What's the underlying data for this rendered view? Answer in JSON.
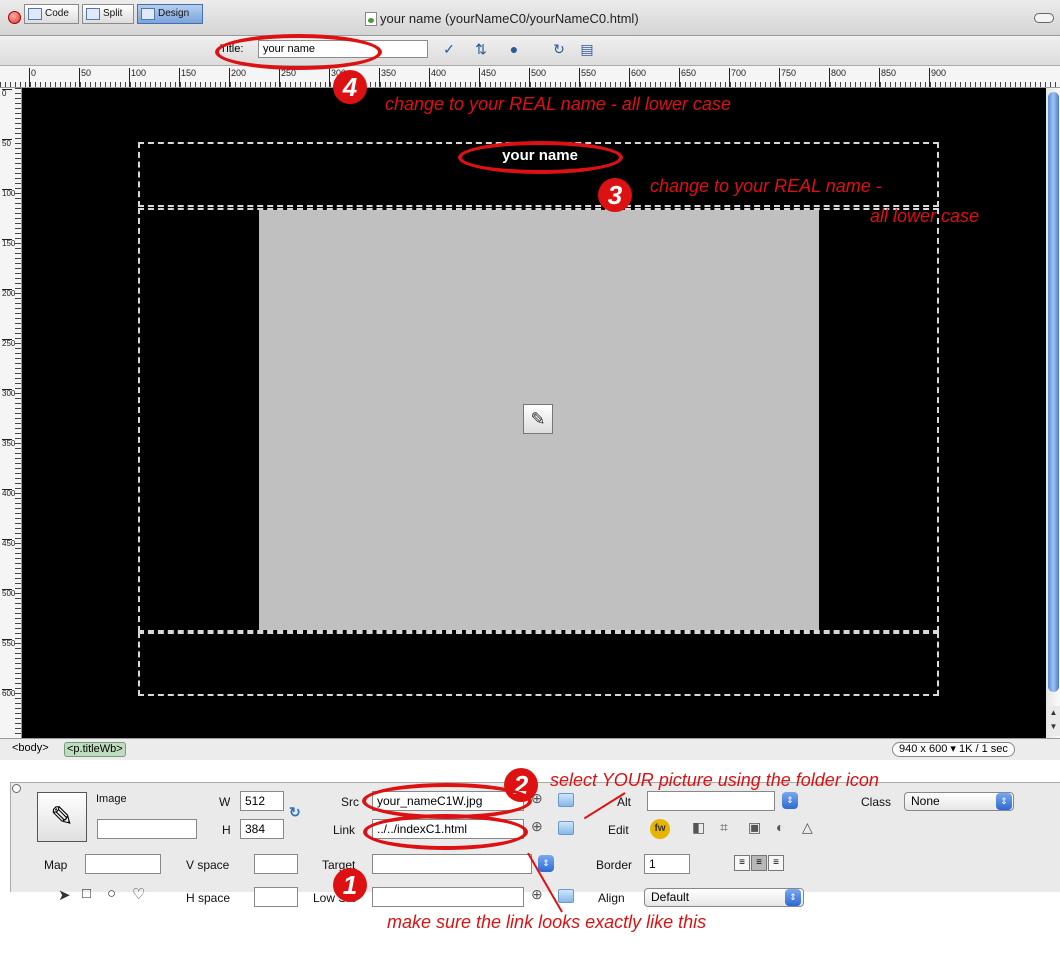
{
  "window": {
    "title": "your name (yourNameC0/yourNameC0.html)"
  },
  "toolbar": {
    "code_label": "Code",
    "split_label": "Split",
    "design_label": "Design",
    "title_label": "Title:",
    "title_value": "your name"
  },
  "ruler": {
    "ticks": [
      "0",
      "50",
      "100",
      "150",
      "200",
      "250",
      "300",
      "350",
      "400",
      "450",
      "500",
      "550",
      "600",
      "650",
      "700",
      "750",
      "800",
      "850",
      "900"
    ]
  },
  "page": {
    "site_name": "your name"
  },
  "status": {
    "tag_body": "<body>",
    "tag_p": "<p.titleWb>",
    "window_size": "940 x 600",
    "download": "1K / 1 sec"
  },
  "properties": {
    "image_label": "Image",
    "w_label": "W",
    "w_value": "512",
    "h_label": "H",
    "h_value": "384",
    "src_label": "Src",
    "src_value": "your_nameC1W.jpg",
    "link_label": "Link",
    "link_value": "../../indexC1.html",
    "alt_label": "Alt",
    "edit_label": "Edit",
    "class_label": "Class",
    "class_value": "None",
    "map_label": "Map",
    "vspace_label": "V space",
    "target_label": "Target",
    "border_label": "Border",
    "border_value": "1",
    "hspace_label": "H space",
    "lowsrc_label": "Low Src",
    "align_label": "Align",
    "align_value": "Default"
  },
  "annotations": {
    "n1": "1",
    "n2": "2",
    "n3": "3",
    "n4": "4",
    "a4": "change to your REAL name - all lower case",
    "a3_line1": "change to your REAL name -",
    "a3_line2": "all lower case",
    "a2": "select YOUR picture using the folder icon",
    "a1": "make sure the link looks exactly like this"
  },
  "colors": {
    "annotation": "#dd1111",
    "canvas": "#000000",
    "placeholder": "#c0c0c0"
  }
}
